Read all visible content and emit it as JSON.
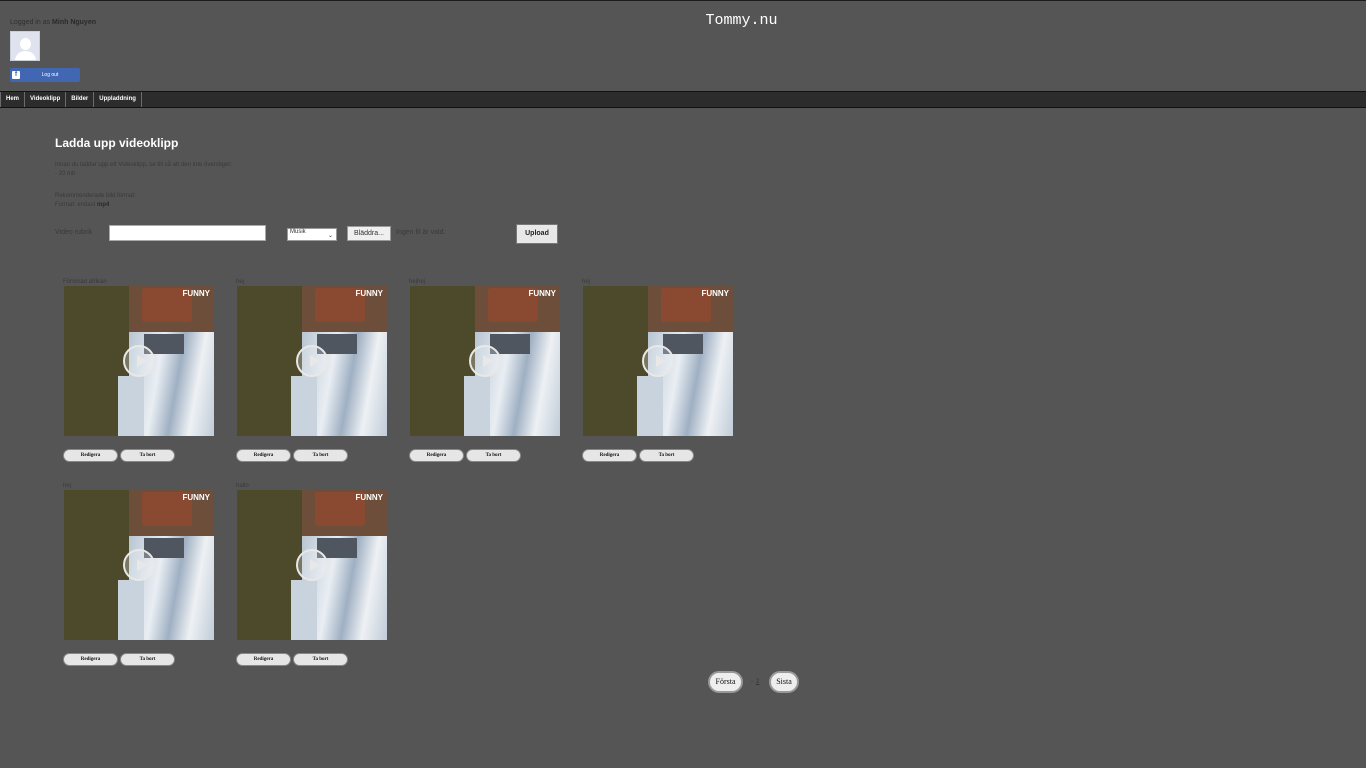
{
  "site": {
    "title": "Tommy.nu"
  },
  "user": {
    "logged_in_prefix": "Logged in as ",
    "name": "Minh Nguyen",
    "logout_label": "Log out"
  },
  "nav": {
    "items": [
      {
        "label": "Hem"
      },
      {
        "label": "Videoklipp"
      },
      {
        "label": "Bilder"
      },
      {
        "label": "Uppladdning"
      }
    ]
  },
  "upload": {
    "heading": "Ladda upp videoklipp",
    "info_line1": "Innan du laddar upp ett Videoklipp, se till så att den inte överstiger:",
    "info_line2": "- 20 mb",
    "info_line3": "Rekommenderade bild format:",
    "info_line4_prefix": "Format: endast ",
    "info_line4_format": "mp4",
    "title_label": "Video rubrik",
    "title_value": "",
    "category_value": "Musik",
    "browse_label": "Bläddra...",
    "no_file_label": "Ingen fil är vald.",
    "upload_label": "Upload"
  },
  "videos": [
    {
      "title": "Förvirrad afrikan",
      "edit_label": "Redigera",
      "delete_label": "Ta bort",
      "logo": "FUNNY"
    },
    {
      "title": "hej",
      "edit_label": "Redigera",
      "delete_label": "Ta bort",
      "logo": "FUNNY"
    },
    {
      "title": "hejhej",
      "edit_label": "Redigera",
      "delete_label": "Ta bort",
      "logo": "FUNNY"
    },
    {
      "title": "hej",
      "edit_label": "Redigera",
      "delete_label": "Ta bort",
      "logo": "FUNNY"
    },
    {
      "title": "hej",
      "edit_label": "Redigera",
      "delete_label": "Ta bort",
      "logo": "FUNNY"
    },
    {
      "title": "hallo",
      "edit_label": "Redigera",
      "delete_label": "Ta bort",
      "logo": "FUNNY"
    }
  ],
  "pagination": {
    "first_label": "Första",
    "separator": "-",
    "current_page": "2",
    "last_label": "Sista"
  },
  "colors": {
    "background": "#555555",
    "navbar": "#2c2c2c",
    "facebook": "#4267b2"
  }
}
